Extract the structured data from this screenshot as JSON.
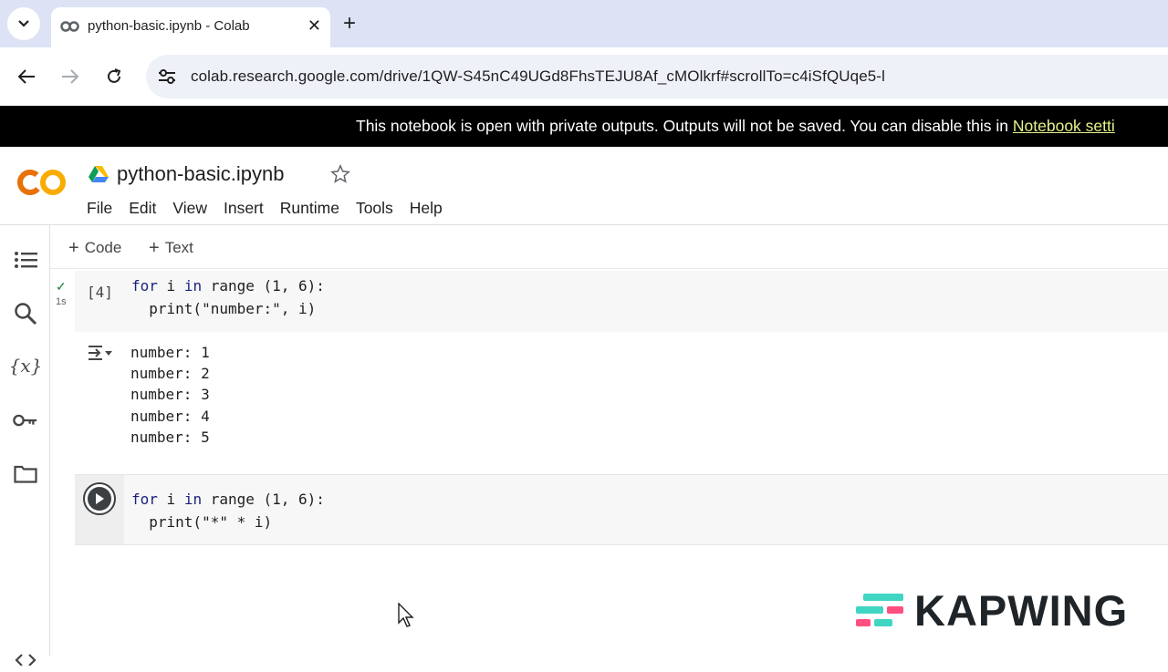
{
  "browser": {
    "tab_title": "python-basic.ipynb - Colab",
    "url": "colab.research.google.com/drive/1QW-S45nC49UGd8FhsTEJU8Af_cMOlkrf#scrollTo=c4iSfQUqe5-l"
  },
  "banner": {
    "text": "This notebook is open with private outputs. Outputs will not be saved. You can disable this in ",
    "link": "Notebook setti"
  },
  "header": {
    "logo": "CO",
    "notebook_title": "python-basic.ipynb",
    "menu": [
      "File",
      "Edit",
      "View",
      "Insert",
      "Runtime",
      "Tools",
      "Help"
    ]
  },
  "toolbar": {
    "code_label": "Code",
    "text_label": "Text"
  },
  "cells": [
    {
      "exec_count": "[4]",
      "status_check": "✓",
      "duration": "1s",
      "line1_kw1": "for",
      "line1_mid": " i ",
      "line1_kw2": "in",
      "line1_rest": " range (1, 6):",
      "line2": "print(\"number:\", i)",
      "output": [
        "number: 1",
        "number: 2",
        "number: 3",
        "number: 4",
        "number: 5"
      ]
    },
    {
      "line1_kw1": "for",
      "line1_mid": " i ",
      "line1_kw2": "in",
      "line1_rest": " range (1, 6):",
      "line2": "print(\"*\" * i)"
    }
  ],
  "watermark": {
    "text": "KAPWING"
  },
  "colors": {
    "tabstrip": "#dde3f5",
    "banner_bg": "#000000",
    "banner_link": "#e7f28b",
    "colab_orange": "#f9ab00",
    "run_check": "#188038"
  }
}
